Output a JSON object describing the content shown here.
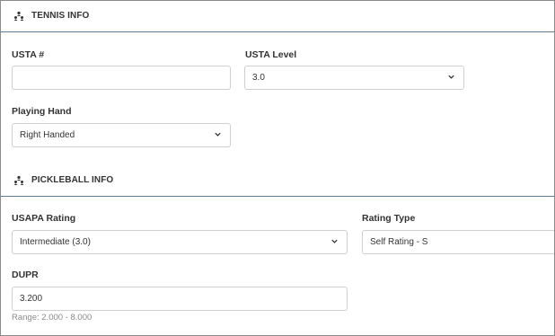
{
  "tennis": {
    "header": "TENNIS INFO",
    "usta_number": {
      "label": "USTA #",
      "value": ""
    },
    "usta_level": {
      "label": "USTA Level",
      "value": "3.0"
    },
    "playing_hand": {
      "label": "Playing Hand",
      "value": "Right Handed"
    }
  },
  "pickleball": {
    "header": "PICKLEBALL INFO",
    "usapa_rating": {
      "label": "USAPA Rating",
      "value": "Intermediate (3.0)"
    },
    "rating_type": {
      "label": "Rating Type",
      "value": "Self Rating - S"
    },
    "dupr": {
      "label": "DUPR",
      "value": "3.200",
      "hint": "Range: 2.000 - 8.000"
    }
  },
  "icons": {
    "section": "players-icon",
    "dropdown": "chevron-down-icon"
  },
  "colors": {
    "divider": "#5d7a93",
    "border": "#cfcfcf",
    "hint": "#8a8a8a"
  }
}
